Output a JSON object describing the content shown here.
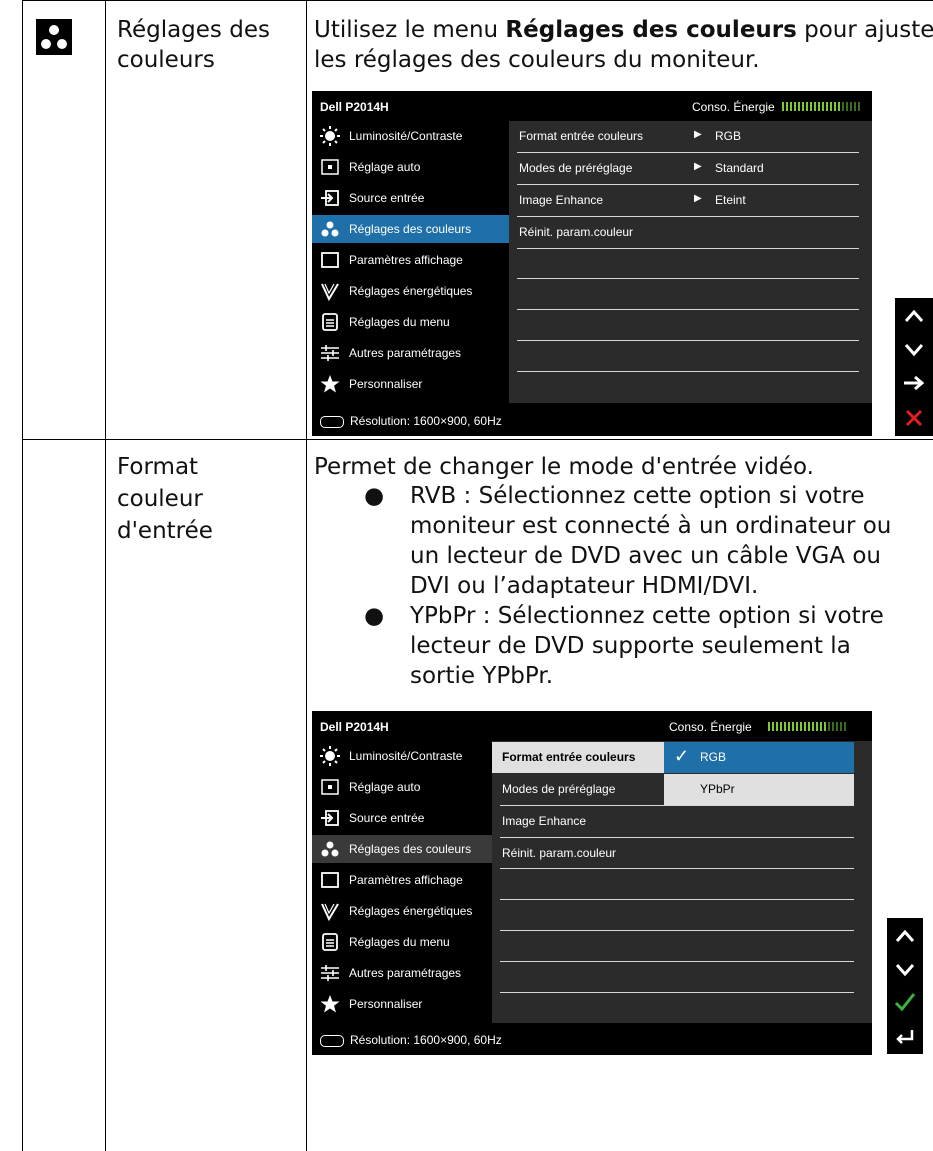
{
  "row1": {
    "title": [
      "Réglages des",
      "couleurs"
    ],
    "desc_pre": "Utilisez le menu ",
    "desc_bold": "Réglages des couleurs",
    "desc_post": " pour ajuster",
    "desc_line2": "les réglages des couleurs du moniteur."
  },
  "row2": {
    "title": [
      "Format",
      "couleur",
      "d'entrée"
    ],
    "desc_intro": "Permet de changer le mode d'entrée vidéo.",
    "bullet1": [
      "RVB : Sélectionnez cette option si votre",
      "moniteur est connecté à un ordinateur ou",
      "un lecteur de DVD avec un câble VGA ou",
      "DVI ou l’adaptateur HDMI/DVI."
    ],
    "bullet2": [
      "YPbPr : Sélectionnez cette option si votre",
      "lecteur de DVD supporte seulement la",
      "sortie YPbPr."
    ]
  },
  "osd1": {
    "model": "Dell P2014H",
    "energy": "Conso. Énergie",
    "menu": [
      "Luminosité/Contraste",
      "Réglage auto",
      "Source entrée",
      "Réglages des couleurs",
      "Paramètres affichage",
      "Réglages énergétiques",
      "Réglages du menu",
      "Autres paramétrages",
      "Personnaliser"
    ],
    "selected_index": 3,
    "settings": [
      {
        "label": "Format entrée couleurs",
        "value": "RGB"
      },
      {
        "label": "Modes de préréglage",
        "value": "Standard"
      },
      {
        "label": "Image Enhance",
        "value": "Eteint"
      },
      {
        "label": "Réinit. param.couleur",
        "value": ""
      }
    ],
    "footer": "Résolution:  1600×900,  60Hz"
  },
  "osd2": {
    "model": "Dell P2014H",
    "energy": "Conso. Énergie",
    "menu": [
      "Luminosité/Contraste",
      "Réglage auto",
      "Source entrée",
      "Réglages des couleurs",
      "Paramètres affichage",
      "Réglages énergétiques",
      "Réglages du menu",
      "Autres paramétrages",
      "Personnaliser"
    ],
    "settings": [
      "Format entrée couleurs",
      "Modes de préréglage",
      "Image Enhance",
      "Réinit. param.couleur"
    ],
    "options": [
      "RGB",
      "YPbPr"
    ],
    "selected_option": "RGB",
    "footer": "Résolution:  1600×900,  60Hz"
  },
  "nav1": [
    "up-arrow",
    "down-arrow",
    "right-arrow",
    "exit-x"
  ],
  "nav2": [
    "up-arrow",
    "down-arrow",
    "check",
    "back"
  ],
  "colors": {
    "accent_blue": "#1f6fa8",
    "exit_red": "#e02020",
    "check_green": "#3cb043"
  }
}
